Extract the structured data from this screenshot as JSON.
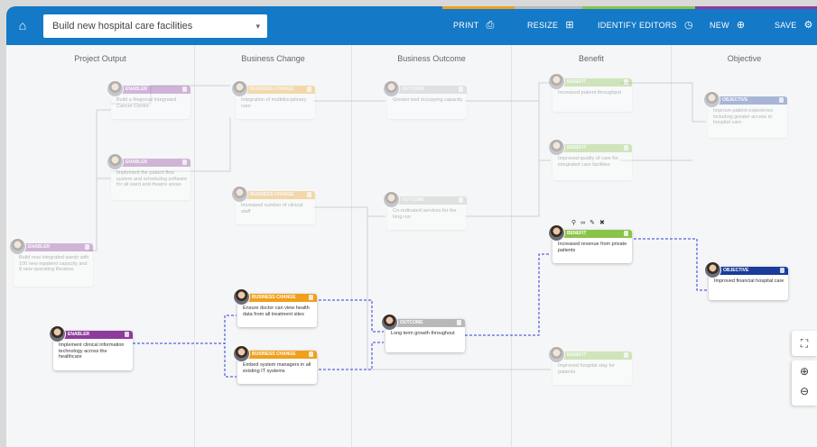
{
  "topbar": {
    "project": "Build new hospital care facilities",
    "print_label": "PRINT",
    "resize_label": "RESIZE",
    "identify_editors_label": "IDENTIFY EDITORS",
    "new_label": "NEW",
    "save_label": "SAVE"
  },
  "columns": [
    {
      "title": "Project Output"
    },
    {
      "title": "Business Change"
    },
    {
      "title": "Business Outcome"
    },
    {
      "title": "Benefit"
    },
    {
      "title": "Objective"
    }
  ],
  "colors": {
    "topbar": "#1479c6",
    "enabler": "#8e3b9e",
    "change": "#f0a01c",
    "outcome": "#b8b8b8",
    "benefit": "#8bc34a",
    "objective": "#1a3c9a",
    "link": "#2d3fd8"
  },
  "cards": {
    "c1": {
      "tag": "ENABLER",
      "text": "Build a Regional Integrated Cancer Centre"
    },
    "c2": {
      "tag": "ENABLER",
      "text": "Implement the patient flow system and scheduling software for all ward and theatre areas"
    },
    "c3": {
      "tag": "ENABLER",
      "text": "Build new integrated wards with 100 new inpatient capacity and 8 new operating theatres"
    },
    "c4": {
      "tag": "ENABLER",
      "text": "Implement clinical information technology across the healthcare"
    },
    "c5": {
      "tag": "BUSINESS CHANGE",
      "text": "Integration of multidisciplinary care"
    },
    "c6": {
      "tag": "BUSINESS CHANGE",
      "text": "Increased number of clinical staff"
    },
    "c7": {
      "tag": "BUSINESS CHANGE",
      "text": "Ensure doctor can view health data from all treatment sites"
    },
    "c8": {
      "tag": "BUSINESS CHANGE",
      "text": "Embed system managers in all existing IT systems"
    },
    "c9": {
      "tag": "OUTCOME",
      "text": "Greater bed occupying capacity"
    },
    "c10": {
      "tag": "OUTCOME",
      "text": "Co-ordinated services for the long run"
    },
    "c11": {
      "tag": "OUTCOME",
      "text": "Long term growth throughout"
    },
    "c12": {
      "tag": "BENEFIT",
      "text": "Increased patient throughput"
    },
    "c13": {
      "tag": "BENEFIT",
      "text": "Improved quality of care for integrated care facilities"
    },
    "c14": {
      "tag": "BENEFIT",
      "text": "Increased revenue from private patients"
    },
    "c15": {
      "tag": "BENEFIT",
      "text": "Improved hospital stay for patients"
    },
    "c16": {
      "tag": "OBJECTIVE",
      "text": "Improve patient experience including greater access to hospital care"
    },
    "c17": {
      "tag": "OBJECTIVE",
      "text": "Improved financial hospital care"
    }
  }
}
